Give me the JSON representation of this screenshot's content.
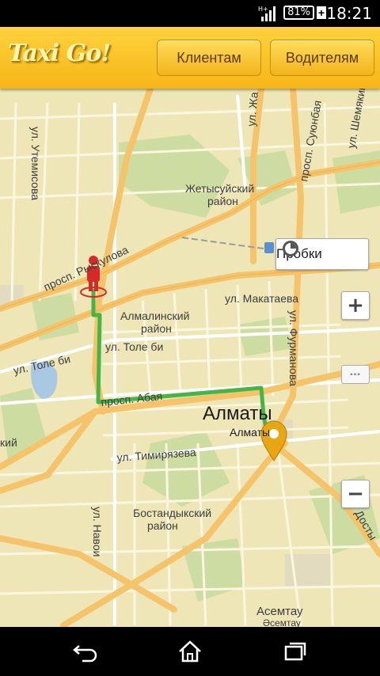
{
  "status_bar": {
    "time": "18:21",
    "battery": "81%"
  },
  "header": {
    "logo": "Taxi Go!",
    "clients_button": "Клиентам",
    "drivers_button": "Водителям"
  },
  "map": {
    "city": "Алматы",
    "city_sub": "Алматы",
    "districts": {
      "zhetysu_1": "Жетысуйский",
      "zhetysu_2": "район",
      "almaly_1": "Алмалинский",
      "almaly_2": "район",
      "bostandyk_1": "Бостандыкский",
      "bostandyk_2": "район"
    },
    "streets": {
      "raiymbek": "просп. Рыскулова",
      "makataev": "ул. Макатаева",
      "tole_bi_1": "ул. Толе би",
      "tole_bi_2": "ул. Толе би",
      "abai": "просп. Абая",
      "timiryazev": "ул. Тимирязева",
      "navoi": "ул. Навои",
      "utemisov": "ул. Утемисова",
      "furmanov": "ул. Фурманова",
      "suyunbai": "просп. Суюнбая",
      "shemyakin": "ул. Шемякин",
      "zhambyl": "ул. Жа",
      "dostyk": "Досты"
    },
    "places": {
      "asemtau": "Асемтау",
      "asemtau_kz": "Әсемтау",
      "left_edge": "кий"
    },
    "traffic_button": "Пробки",
    "zoom_in": "+",
    "zoom_out": "−"
  },
  "colors": {
    "route": "#46b548",
    "accent": "#f5b51b",
    "pin": "#e8a613",
    "person": "#d62a2a"
  }
}
